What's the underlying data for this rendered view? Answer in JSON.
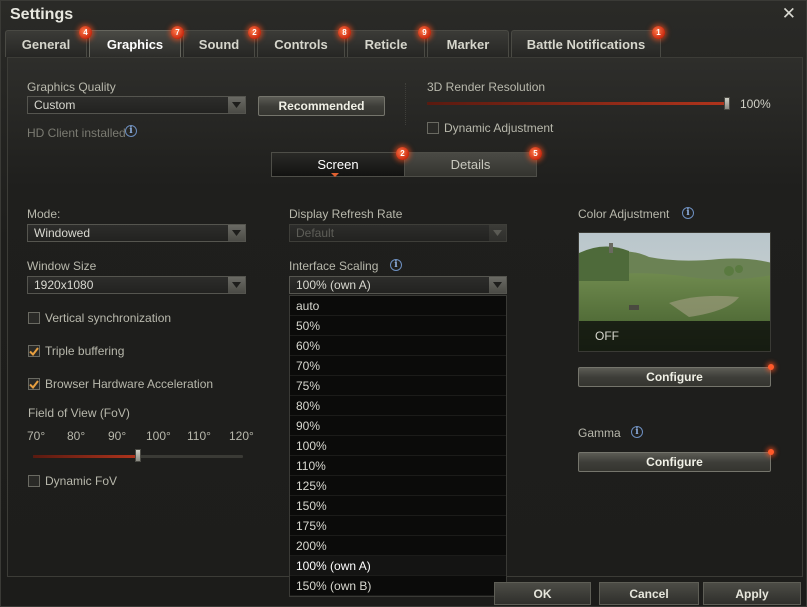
{
  "window": {
    "title": "Settings"
  },
  "tabs": [
    {
      "label": "General",
      "badge": "4"
    },
    {
      "label": "Graphics",
      "badge": "7"
    },
    {
      "label": "Sound",
      "badge": "2"
    },
    {
      "label": "Controls",
      "badge": "8"
    },
    {
      "label": "Reticle",
      "badge": "9"
    },
    {
      "label": "Marker",
      "badge": ""
    },
    {
      "label": "Battle Notifications",
      "badge": "1"
    }
  ],
  "graphics_quality": {
    "label": "Graphics Quality",
    "value": "Custom",
    "recommended_button": "Recommended",
    "hd_client_text": "HD Client installed"
  },
  "render_resolution": {
    "label": "3D Render Resolution",
    "value_text": "100%",
    "level": 1.0,
    "dynamic_adjustment_label": "Dynamic Adjustment",
    "dynamic_adjustment_checked": false
  },
  "subtabs": [
    {
      "label": "Screen",
      "badge": "2"
    },
    {
      "label": "Details",
      "badge": "5"
    }
  ],
  "mode": {
    "label": "Mode:",
    "value": "Windowed"
  },
  "window_size": {
    "label": "Window Size",
    "value": "1920x1080"
  },
  "checkboxes": [
    {
      "label": "Vertical synchronization",
      "checked": false
    },
    {
      "label": "Triple buffering",
      "checked": true
    },
    {
      "label": "Browser Hardware Acceleration",
      "checked": true
    }
  ],
  "fov": {
    "label": "Field of View (FoV)",
    "ticks": [
      "70°",
      "80°",
      "90°",
      "100°",
      "110°",
      "120°"
    ],
    "value_degrees": 95,
    "dynamic_label": "Dynamic FoV",
    "dynamic_checked": false
  },
  "refresh_rate": {
    "label": "Display Refresh Rate",
    "value": "Default",
    "disabled": true
  },
  "interface_scaling": {
    "label": "Interface Scaling",
    "value": "100% (own A)",
    "options": [
      "auto",
      "50%",
      "60%",
      "70%",
      "75%",
      "80%",
      "90%",
      "100%",
      "110%",
      "125%",
      "150%",
      "175%",
      "200%",
      "100% (own A)",
      "150% (own B)"
    ],
    "selected_index": 13
  },
  "color_adjustment": {
    "label": "Color Adjustment",
    "preview_state": "OFF",
    "configure_button": "Configure"
  },
  "gamma": {
    "label": "Gamma",
    "configure_button": "Configure"
  },
  "footer": {
    "ok": "OK",
    "cancel": "Cancel",
    "apply": "Apply"
  },
  "colors": {
    "badge": "#d8341a",
    "slider_fill": "#b0341c",
    "info_icon": "#8fb0e0"
  }
}
